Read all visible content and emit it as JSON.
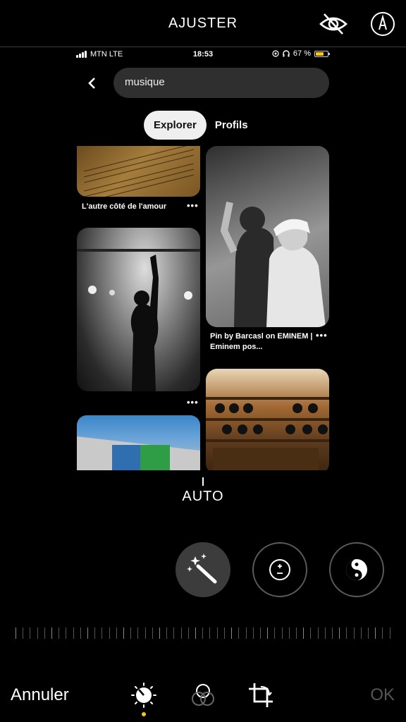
{
  "editor": {
    "title": "AJUSTER",
    "auto_label": "AUTO",
    "cancel_label": "Annuler",
    "ok_label": "OK",
    "accent_color": "#f5c518"
  },
  "phone": {
    "status": {
      "carrier": "MTN  LTE",
      "time": "18:53",
      "battery": "67 %",
      "battery_level": 0.67
    },
    "search": {
      "query": "musique"
    },
    "tabs": [
      {
        "label": "Explorer",
        "active": true
      },
      {
        "label": "Profils",
        "active": false
      }
    ],
    "pins": [
      {
        "caption": "L'autre côté de l'amour",
        "more": "•••"
      },
      {
        "caption": "Pin by Barcasl on EMINEM | Eminem pos...",
        "more": "•••"
      },
      {
        "caption": "",
        "more": "•••"
      }
    ],
    "nav": [
      "home-icon",
      "search-icon",
      "plus-icon",
      "messages-icon",
      "profile-icon"
    ],
    "notification_color": "#e60023"
  },
  "icons": {
    "top": [
      "hide-eye-icon",
      "markup-icon"
    ],
    "adjustments": [
      "auto-enhance-wand-icon",
      "exposure-icon",
      "brilliance-icon"
    ],
    "tools": [
      "adjust-dial-icon",
      "filters-icon",
      "crop-rotate-icon"
    ]
  }
}
